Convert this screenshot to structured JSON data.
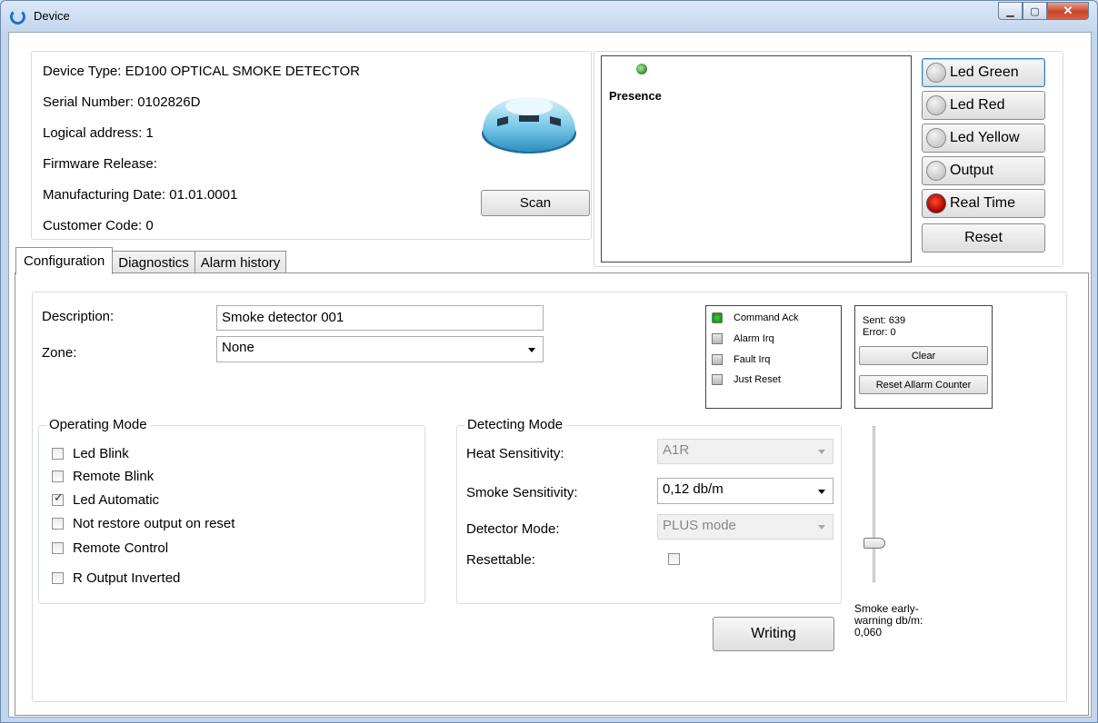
{
  "window": {
    "title": "Device"
  },
  "info": {
    "device_type": "Device Type: ED100 OPTICAL SMOKE DETECTOR",
    "serial": "Serial Number: 0102826D",
    "logical_address": "Logical address: 1",
    "firmware": "Firmware Release:",
    "manufacturing_date": "Manufacturing Date: 01.01.0001",
    "customer_code": "Customer Code: 0",
    "scan_label": "Scan"
  },
  "status": {
    "presence_label": "Presence",
    "buttons": {
      "led_green": "Led Green",
      "led_red": "Led Red",
      "led_yellow": "Led Yellow",
      "output": "Output",
      "real_time": "Real Time",
      "reset": "Reset"
    }
  },
  "tabs": {
    "configuration": "Configuration",
    "diagnostics": "Diagnostics",
    "alarm_history": "Alarm history"
  },
  "config": {
    "description_label": "Description:",
    "description_value": "Smoke detector 001",
    "zone_label": "Zone:",
    "zone_value": "None",
    "flags": {
      "command_ack": "Command Ack",
      "alarm_irq": "Alarm Irq",
      "fault_irq": "Fault Irq",
      "just_reset": "Just Reset"
    },
    "counters": {
      "sent": "Sent: 639",
      "error": "Error: 0",
      "clear": "Clear",
      "reset_alarm_counter": "Reset Allarm Counter"
    },
    "operating_mode": {
      "title": "Operating Mode",
      "led_blink": "Led Blink",
      "remote_blink": "Remote Blink",
      "led_automatic": "Led Automatic",
      "not_restore": "Not restore output on reset",
      "remote_control": "Remote Control",
      "r_output_inverted": "R Output Inverted"
    },
    "detecting_mode": {
      "title": "Detecting Mode",
      "heat_label": "Heat Sensitivity:",
      "heat_value": "A1R",
      "smoke_label": "Smoke Sensitivity:",
      "smoke_value": "0,12 db/m",
      "detector_label": "Detector Mode:",
      "detector_value": "PLUS mode",
      "resettable_label": "Resettable:"
    },
    "writing_label": "Writing",
    "early_warning_label": "Smoke early-warning db/m:",
    "early_warning_value": "0,060"
  }
}
